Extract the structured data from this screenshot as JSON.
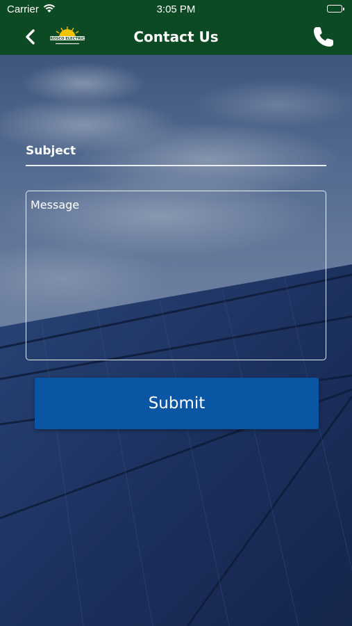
{
  "status_bar": {
    "carrier": "Carrier",
    "time": "3:05 PM"
  },
  "nav": {
    "title": "Contact Us",
    "logo_text": "ROSCO ELECTRIC",
    "back_icon": "chevron-left-icon",
    "phone_icon": "phone-icon"
  },
  "form": {
    "subject_placeholder": "Subject",
    "subject_value": "",
    "message_placeholder": "Message",
    "message_value": "",
    "submit_label": "Submit"
  },
  "colors": {
    "nav_bg": "#0c4a23",
    "submit_bg": "#0a56a5",
    "text": "#ffffff"
  }
}
